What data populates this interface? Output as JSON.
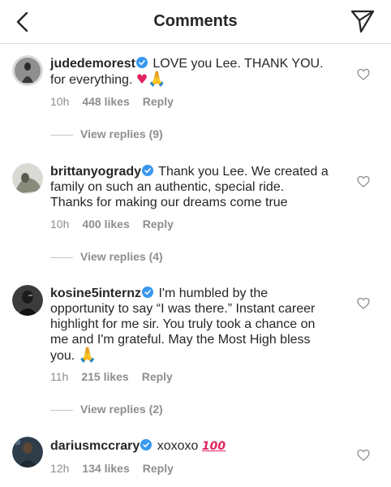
{
  "header": {
    "title": "Comments",
    "back_icon": "chevron-left-icon",
    "share_icon": "paper-plane-icon"
  },
  "comments": [
    {
      "username": "judedemorest",
      "verified": true,
      "text_line1": "LOVE you Lee. THANK YOU.",
      "text_line2": "for everything.",
      "emoji": "❤️🙏",
      "time": "10h",
      "likes": "448 likes",
      "reply": "Reply",
      "view_replies": "View replies (9)"
    },
    {
      "username": "brittanyogrady",
      "verified": true,
      "text_line1": "Thank you Lee. We created a",
      "text_line2": "family on such an authentic, special ride.",
      "text_line3": "Thanks for making our dreams come true",
      "time": "10h",
      "likes": "400 likes",
      "reply": "Reply",
      "view_replies": "View replies (4)"
    },
    {
      "username": "kosine5internz",
      "verified": true,
      "text_line1": "I'm humbled by the",
      "text_line2": "opportunity to say “I was there.” Instant career",
      "text_line3": "highlight for me sir. You truly took a chance on",
      "text_line4": "me and I'm grateful. May the Most High bless",
      "text_line5": "you.",
      "emoji": "🙏🏾",
      "time": "11h",
      "likes": "215 likes",
      "reply": "Reply",
      "view_replies": "View replies (2)"
    },
    {
      "username": "dariusmccrary",
      "verified": true,
      "text_line1": "xoxoxo",
      "emoji": "💯",
      "time": "12h",
      "likes": "134 likes",
      "reply": "Reply"
    }
  ],
  "colors": {
    "text": "#262626",
    "secondary": "#8e8e8e",
    "verified": "#3897f0",
    "divider": "#dbdbdb"
  }
}
